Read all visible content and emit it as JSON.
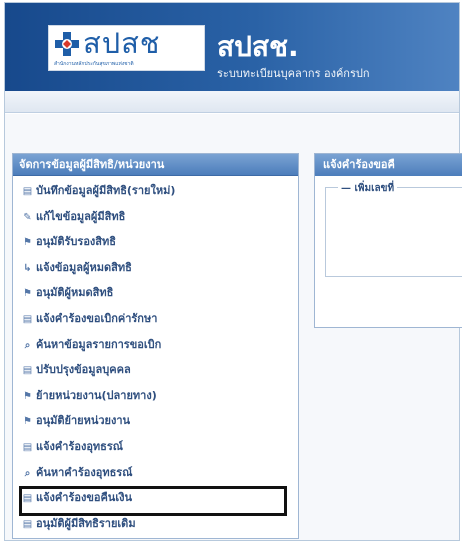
{
  "header": {
    "logo_text": "สปสช",
    "logo_subtitle": "สำนักงานหลักประกันสุขภาพแห่งชาติ",
    "app_title": "สปสช.",
    "app_subtitle": "ระบบทะเบียนบุคลากร องค์กรปก"
  },
  "menu": {
    "title": "จัดการข้อมูลผู้มีสิทธิ/หน่วยงาน",
    "items": [
      {
        "label": "บันทึกข้อมูลผู้มีสิทธิ(รายใหม่)",
        "icon": "form-icon"
      },
      {
        "label": "แก้ไขข้อมูลผู้มีสิทธิ",
        "icon": "edit-icon"
      },
      {
        "label": "อนุมัติรับรองสิทธิ",
        "icon": "flag-icon"
      },
      {
        "label": "แจ้งข้อมูลผู้หมดสิทธิ",
        "icon": "notify-icon"
      },
      {
        "label": "อนุมัติผู้หมดสิทธิ",
        "icon": "flag-icon"
      },
      {
        "label": "แจ้งคำร้องขอเบิกค่ารักษา",
        "icon": "form-icon"
      },
      {
        "label": "ค้นหาข้อมูลรายการขอเบิก",
        "icon": "search-icon"
      },
      {
        "label": "ปรับปรุงข้อมูลบุคคล",
        "icon": "form-icon"
      },
      {
        "label": "ย้ายหน่วยงาน(ปลายทาง)",
        "icon": "flag-icon"
      },
      {
        "label": "อนุมัติย้ายหน่วยงาน",
        "icon": "flag-icon"
      },
      {
        "label": "แจ้งคำร้องอุทธรณ์",
        "icon": "form-icon"
      },
      {
        "label": "ค้นหาคำร้องอุทธรณ์",
        "icon": "search-icon"
      },
      {
        "label": "แจ้งคำร้องขอคืนเงิน",
        "icon": "form-icon",
        "highlighted": true
      },
      {
        "label": "อนุมัติผู้มีสิทธิรายเดิม",
        "icon": "form-icon"
      }
    ]
  },
  "content": {
    "title": "แจ้งคำร้องขอคื",
    "legend": "— เพิ่มเลขที่"
  }
}
